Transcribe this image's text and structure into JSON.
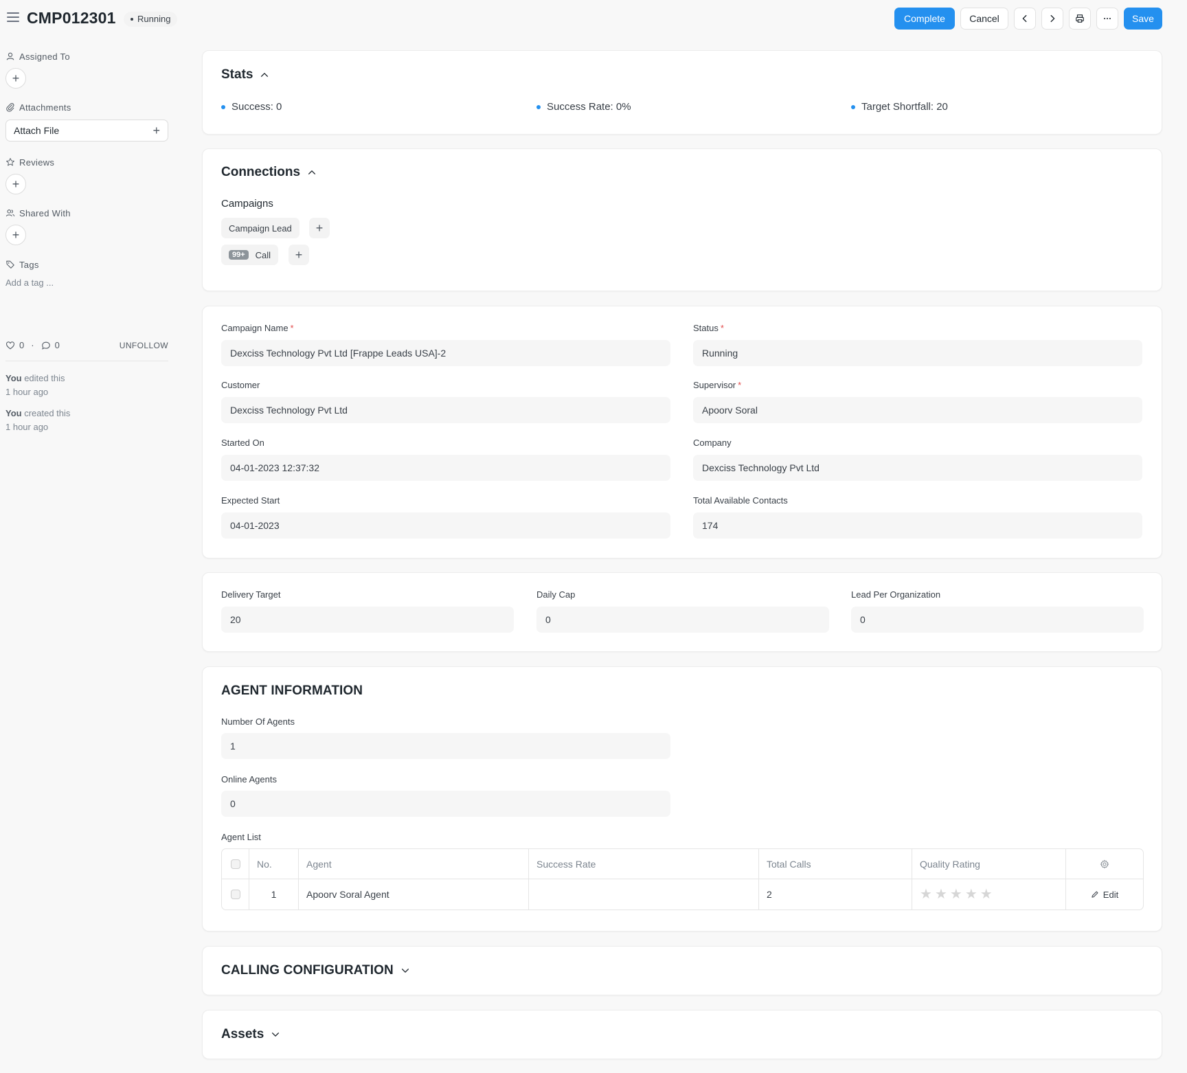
{
  "header": {
    "doc_id": "CMP012301",
    "status": "Running",
    "actions": {
      "complete": "Complete",
      "cancel": "Cancel",
      "save": "Save"
    },
    "icons": [
      "menu-icon",
      "chevron-left-icon",
      "chevron-right-icon",
      "printer-icon",
      "more-icon"
    ]
  },
  "sidebar": {
    "assigned_to": "Assigned To",
    "attachments": "Attachments",
    "attach_file": "Attach File",
    "reviews": "Reviews",
    "shared_with": "Shared With",
    "tags": "Tags",
    "add_tag": "Add a tag ...",
    "likes": "0",
    "comments": "0",
    "unfollow": "UNFOLLOW",
    "activity": [
      {
        "who": "You",
        "what": " edited this",
        "when": "1 hour ago"
      },
      {
        "who": "You",
        "what": " created this",
        "when": "1 hour ago"
      }
    ]
  },
  "stats": {
    "title": "Stats",
    "items": [
      "Success: 0",
      "Success Rate: 0%",
      "Target Shortfall: 20"
    ]
  },
  "connections": {
    "title": "Connections",
    "group": "Campaigns",
    "links": [
      {
        "label": "Campaign Lead",
        "badge": ""
      },
      {
        "label": "Call",
        "badge": "99+"
      }
    ]
  },
  "details": {
    "campaign_name": {
      "label": "Campaign Name",
      "value": "Dexciss Technology Pvt Ltd [Frappe Leads USA]-2"
    },
    "status": {
      "label": "Status",
      "value": "Running"
    },
    "customer": {
      "label": "Customer",
      "value": "Dexciss Technology Pvt Ltd"
    },
    "supervisor": {
      "label": "Supervisor",
      "value": "Apoorv Soral"
    },
    "started_on": {
      "label": "Started On",
      "value": "04-01-2023 12:37:32"
    },
    "company": {
      "label": "Company",
      "value": "Dexciss Technology Pvt Ltd"
    },
    "expected_start": {
      "label": "Expected Start",
      "value": "04-01-2023"
    },
    "total_contacts": {
      "label": "Total Available Contacts",
      "value": "174"
    }
  },
  "delivery": {
    "target": {
      "label": "Delivery Target",
      "value": "20"
    },
    "daily_cap": {
      "label": "Daily Cap",
      "value": "0"
    },
    "lead_per_org": {
      "label": "Lead Per Organization",
      "value": "0"
    }
  },
  "agents": {
    "title": "AGENT INFORMATION",
    "num_agents": {
      "label": "Number Of Agents",
      "value": "1"
    },
    "online_agents": {
      "label": "Online Agents",
      "value": "0"
    },
    "list_label": "Agent List",
    "columns": [
      "No.",
      "Agent",
      "Success Rate",
      "Total Calls",
      "Quality Rating"
    ],
    "rows": [
      {
        "no": "1",
        "agent": "Apoorv Soral Agent",
        "success_rate": "",
        "total_calls": "2",
        "rating": 0
      }
    ],
    "edit": "Edit"
  },
  "calling": {
    "title": "CALLING CONFIGURATION"
  },
  "assets": {
    "title": "Assets"
  },
  "colors": {
    "primary": "#2490ef",
    "required": "#e24c4c"
  }
}
